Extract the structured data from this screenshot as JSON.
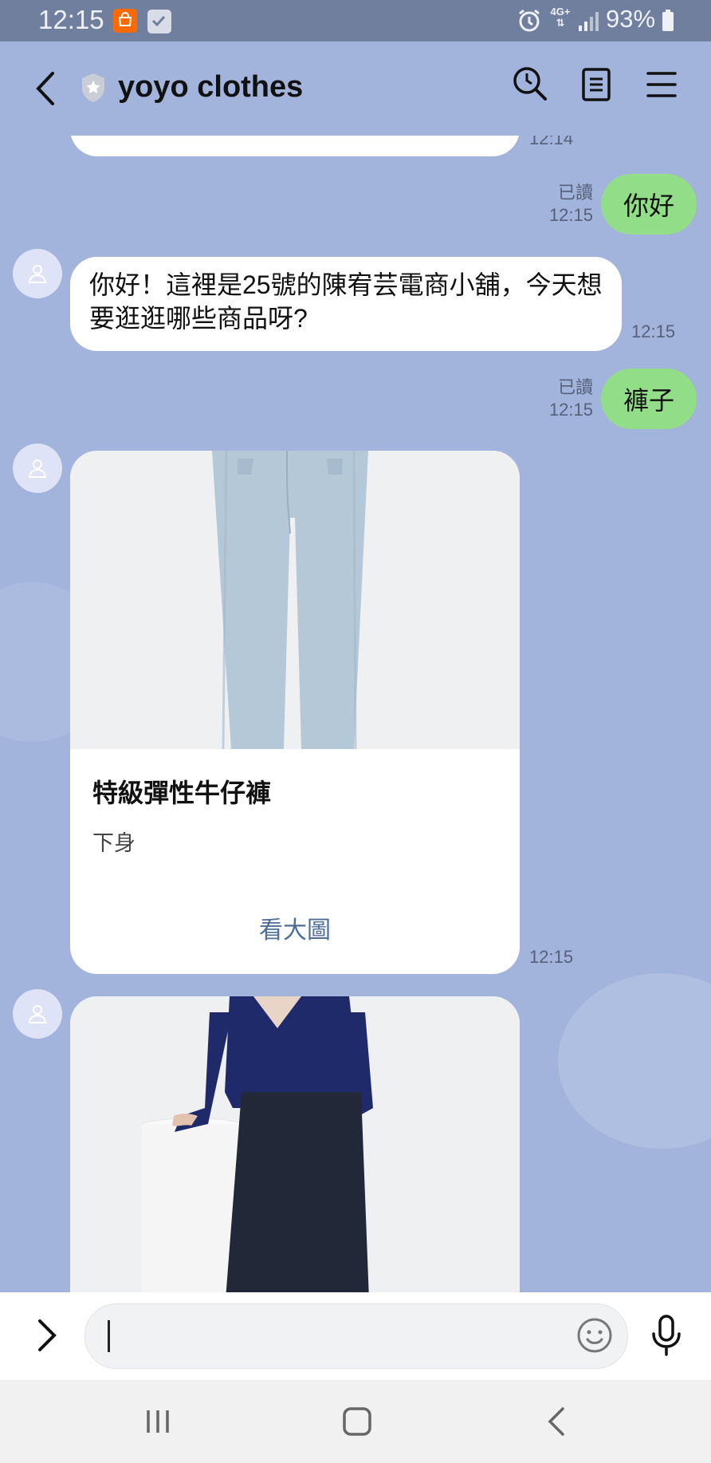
{
  "status_bar": {
    "time": "12:15",
    "battery": "93%",
    "network": "4G+"
  },
  "header": {
    "title": "yoyo clothes"
  },
  "messages": {
    "prev_timestamp": "12:14",
    "m1": {
      "text": "你好",
      "read": "已讀",
      "time": "12:15"
    },
    "m2": {
      "text": "你好！這裡是25號的陳宥芸電商小舖，今天想要逛逛哪些商品呀?",
      "time": "12:15"
    },
    "m3": {
      "text": "褲子",
      "read": "已讀",
      "time": "12:15"
    },
    "card1": {
      "title": "特級彈性牛仔褲",
      "category": "下身",
      "link": "看大圖",
      "time": "12:15"
    }
  },
  "colors": {
    "chat_bg": "#a3b4dc",
    "status_bg": "#6f7f9d",
    "sent_bubble": "#91dd88",
    "link": "#4e6e96"
  },
  "icons": {
    "back": "chevron-left-icon",
    "shield": "shield-star-icon",
    "search": "search-clock-icon",
    "notes": "notes-icon",
    "menu": "hamburger-icon",
    "expand": "chevron-right-icon",
    "emoji": "emoji-icon",
    "mic": "microphone-icon"
  }
}
